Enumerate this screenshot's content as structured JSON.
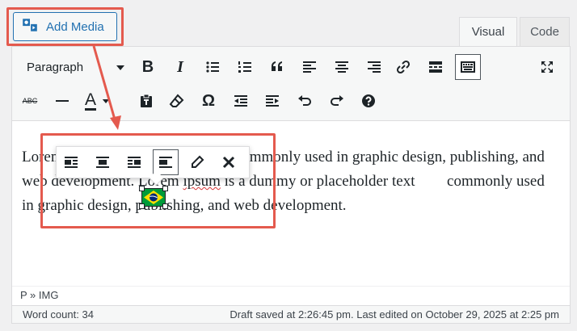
{
  "media_button": {
    "label": "Add Media"
  },
  "tabs": {
    "visual": "Visual",
    "code": "Code"
  },
  "toolbar": {
    "format_select": "Paragraph",
    "text_color_letter": "A",
    "strikethrough_label": "ABC"
  },
  "content": {
    "line_parts": [
      "Lorem ipsum is a placeholder text commonly used in graphic design, publishing, and web development. ",
      "Lorem ",
      "ipsum",
      " is a dummy or placeholder text ",
      " commonly used in graphic design, publishing, and web development."
    ]
  },
  "image": {
    "description": "brazil-flag"
  },
  "path": "P » IMG",
  "status": {
    "word_count": "Word count: 34",
    "draft": "Draft saved at 2:26:45 pm. Last edited on October 29, 2025 at 2:25 pm"
  },
  "colors": {
    "accent": "#2271b1",
    "highlight": "#e45a4e",
    "spell": "#d63638"
  }
}
